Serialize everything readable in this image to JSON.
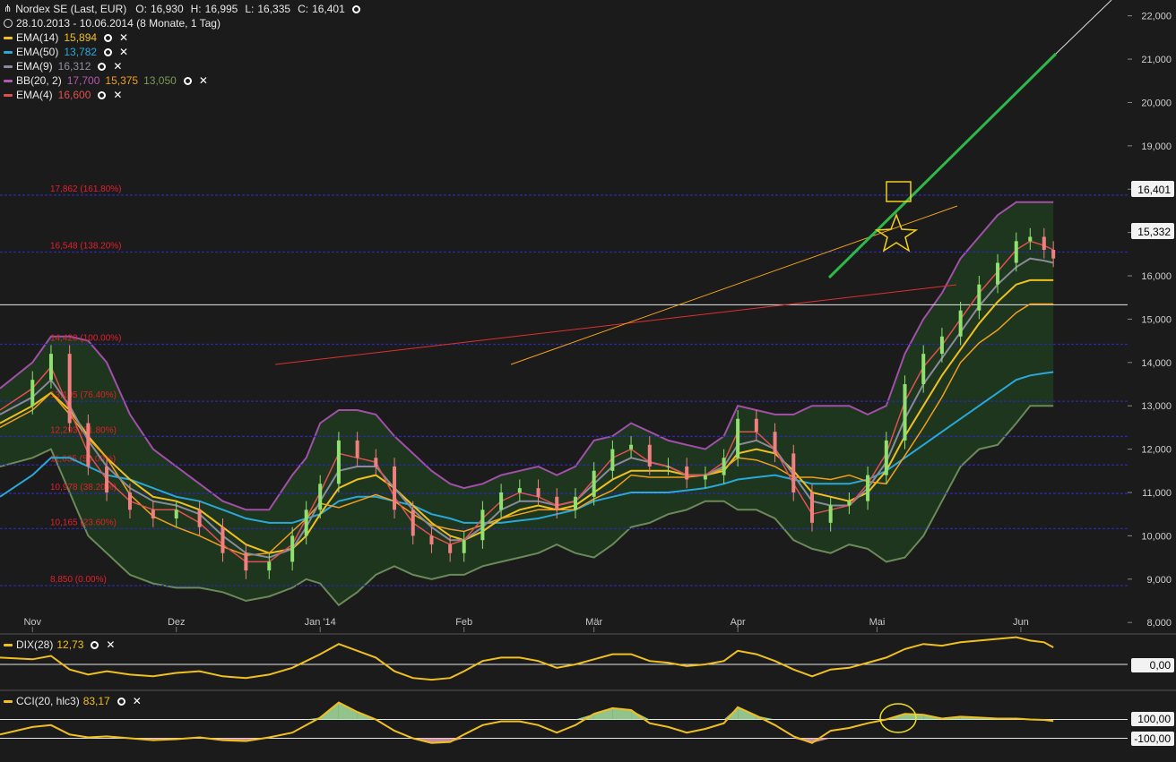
{
  "header": {
    "title": "Nordex SE (Last, EUR)",
    "ohlc": {
      "o_label": "O:",
      "o": "16,930",
      "h_label": "H:",
      "h": "16,995",
      "l_label": "L:",
      "l": "16,335",
      "c_label": "C:",
      "c": "16,401"
    },
    "period": "28.10.2013 - 10.06.2014 (8 Monate, 1 Tag)"
  },
  "indicators": [
    {
      "label": "EMA(14)",
      "values": [
        "15,894"
      ],
      "colors": [
        "#f0c020"
      ],
      "swatch": "#f0c020"
    },
    {
      "label": "EMA(50)",
      "values": [
        "13,782"
      ],
      "colors": [
        "#2aa8d8"
      ],
      "swatch": "#2aa8d8"
    },
    {
      "label": "EMA(9)",
      "values": [
        "16,312"
      ],
      "colors": [
        "#9090a0"
      ],
      "swatch": "#8a8a9a"
    },
    {
      "label": "BB(20, 2)",
      "values": [
        "17,700",
        "15,375",
        "13,050"
      ],
      "colors": [
        "#b05ab0",
        "#f0a020",
        "#7a9a5a"
      ],
      "swatch": "#b05ab0"
    },
    {
      "label": "EMA(4)",
      "values": [
        "16,600"
      ],
      "colors": [
        "#e05050"
      ],
      "swatch": "#e05050"
    }
  ],
  "price_tags": {
    "last": "16,401",
    "line": "15,332"
  },
  "fib_levels": [
    {
      "label": "17,862 (161.80%)",
      "value": 17.862
    },
    {
      "label": "16,548 (138.20%)",
      "value": 16.548
    },
    {
      "label": "14,420 (100.00%)",
      "value": 14.42
    },
    {
      "label": "13,105 (76.40%)",
      "value": 13.105
    },
    {
      "label": "12,293 (61.80%)",
      "value": 12.293
    },
    {
      "label": "11,635 (50.00%)",
      "value": 11.635
    },
    {
      "label": "10,978 (38.20%)",
      "value": 10.978
    },
    {
      "label": "10,165 (23.60%)",
      "value": 10.165
    },
    {
      "label": "8,850 (0.00%)",
      "value": 8.85
    }
  ],
  "dix": {
    "label": "DIX(28)",
    "value": "12,73",
    "zero_tag": "0,00",
    "color": "#f0c020"
  },
  "cci": {
    "label": "CCI(20, hlc3)",
    "value": "83,17",
    "tags": [
      "100,00",
      "-100,00"
    ],
    "color": "#f0c020"
  },
  "colors": {
    "background": "#1b1b1b",
    "band_fill": "#1e3a1e",
    "fib_line": "#2a2aa8",
    "fib_text": "#e02030",
    "up": "#90e070",
    "down": "#f08080"
  },
  "chart_data": {
    "type": "candlestick",
    "title": "Nordex SE (Last, EUR)",
    "ylim": [
      7.9,
      22.2
    ],
    "yticks": [
      "22,000",
      "21,000",
      "20,000",
      "19,000",
      "18,000",
      "17,000",
      "16,000",
      "15,000",
      "14,000",
      "13,000",
      "12,000",
      "11,000",
      "10,000",
      "9,000",
      "8,000"
    ],
    "ytick_values": [
      22,
      21,
      20,
      19,
      18,
      17,
      16,
      15,
      14,
      13,
      12,
      11,
      10,
      9,
      8
    ],
    "x_labels": [
      "Nov",
      "Dez",
      "Jan '14",
      "Feb",
      "Mär",
      "Apr",
      "Mai",
      "Jun"
    ],
    "x_label_days": [
      4,
      35,
      66,
      97,
      125,
      156,
      186,
      217
    ],
    "x_range_days": [
      -3,
      240
    ],
    "close_series_days": [
      -3,
      4,
      8,
      12,
      16,
      20,
      25,
      30,
      35,
      40,
      45,
      50,
      55,
      60,
      63,
      66,
      70,
      74,
      78,
      82,
      86,
      90,
      94,
      97,
      101,
      105,
      109,
      113,
      117,
      121,
      125,
      129,
      133,
      137,
      141,
      145,
      149,
      153,
      156,
      160,
      164,
      168,
      172,
      176,
      180,
      184,
      188,
      192,
      196,
      200,
      204,
      208,
      212,
      216,
      219,
      222,
      224
    ],
    "close_series": [
      13.0,
      13.6,
      14.2,
      12.6,
      11.6,
      11.0,
      10.6,
      10.4,
      10.6,
      10.2,
      9.6,
      9.2,
      9.4,
      10.0,
      10.6,
      11.2,
      12.2,
      11.8,
      11.6,
      10.6,
      10.0,
      9.8,
      9.6,
      9.9,
      10.6,
      11.0,
      11.1,
      10.9,
      10.6,
      10.9,
      11.5,
      12.0,
      12.1,
      11.6,
      11.6,
      11.3,
      11.4,
      11.8,
      12.7,
      12.4,
      11.9,
      11.0,
      10.3,
      10.7,
      10.8,
      11.4,
      12.2,
      13.5,
      14.2,
      14.6,
      15.2,
      15.8,
      16.3,
      16.8,
      16.9,
      16.6,
      16.4
    ],
    "band_upper": [
      13.4,
      14.0,
      14.6,
      14.6,
      14.5,
      14.0,
      12.8,
      12.0,
      11.6,
      11.2,
      10.8,
      10.6,
      10.6,
      11.4,
      11.8,
      12.6,
      12.9,
      12.9,
      12.8,
      12.3,
      11.9,
      11.5,
      11.2,
      11.1,
      11.2,
      11.4,
      11.5,
      11.6,
      11.4,
      11.6,
      12.2,
      12.3,
      12.6,
      12.4,
      12.2,
      12.1,
      12.0,
      12.3,
      13.0,
      12.9,
      12.8,
      12.8,
      13.0,
      13.0,
      13.0,
      12.8,
      13.0,
      14.2,
      15.0,
      15.6,
      16.4,
      16.9,
      17.4,
      17.7,
      17.7,
      17.7,
      17.7
    ],
    "band_lower": [
      11.6,
      11.8,
      12.0,
      11.0,
      10.0,
      9.6,
      9.1,
      8.9,
      8.8,
      8.8,
      8.7,
      8.5,
      8.6,
      8.8,
      9.0,
      8.9,
      8.4,
      8.7,
      9.1,
      9.3,
      9.1,
      9.0,
      9.1,
      9.1,
      9.3,
      9.4,
      9.5,
      9.6,
      9.8,
      9.6,
      9.5,
      9.8,
      10.2,
      10.3,
      10.5,
      10.6,
      10.8,
      10.8,
      10.6,
      10.6,
      10.4,
      9.9,
      9.7,
      9.6,
      9.8,
      9.7,
      9.4,
      9.5,
      10.0,
      10.8,
      11.6,
      12.0,
      12.1,
      12.6,
      13.0,
      13.0,
      13.0
    ],
    "ema50": [
      10.9,
      11.4,
      11.8,
      11.8,
      11.6,
      11.4,
      11.3,
      11.1,
      10.9,
      10.8,
      10.6,
      10.4,
      10.3,
      10.3,
      10.4,
      10.5,
      10.8,
      10.9,
      10.9,
      10.8,
      10.7,
      10.5,
      10.4,
      10.3,
      10.3,
      10.3,
      10.35,
      10.4,
      10.5,
      10.6,
      10.8,
      10.9,
      11.0,
      11.0,
      11.0,
      11.05,
      11.1,
      11.2,
      11.3,
      11.35,
      11.4,
      11.3,
      11.2,
      11.2,
      11.2,
      11.3,
      11.5,
      11.8,
      12.1,
      12.4,
      12.7,
      13.0,
      13.3,
      13.6,
      13.7,
      13.75,
      13.78
    ],
    "ema14": [
      12.6,
      13.0,
      13.3,
      12.9,
      12.3,
      11.8,
      11.3,
      10.9,
      10.8,
      10.6,
      10.2,
      9.8,
      9.6,
      9.7,
      10.0,
      10.5,
      11.1,
      11.3,
      11.4,
      11.1,
      10.7,
      10.3,
      10.0,
      9.9,
      10.1,
      10.4,
      10.6,
      10.7,
      10.6,
      10.7,
      11.0,
      11.3,
      11.5,
      11.5,
      11.5,
      11.4,
      11.4,
      11.5,
      11.9,
      12.0,
      11.9,
      11.5,
      11.0,
      10.9,
      10.8,
      11.0,
      11.5,
      12.3,
      13.0,
      13.7,
      14.3,
      14.9,
      15.4,
      15.8,
      15.9,
      15.9,
      15.9
    ],
    "ema9": [
      12.8,
      13.2,
      13.6,
      13.0,
      12.2,
      11.6,
      11.1,
      10.8,
      10.7,
      10.5,
      10.0,
      9.6,
      9.5,
      9.7,
      10.2,
      10.8,
      11.5,
      11.6,
      11.6,
      11.1,
      10.6,
      10.2,
      9.9,
      9.9,
      10.2,
      10.6,
      10.8,
      10.8,
      10.7,
      10.8,
      11.2,
      11.6,
      11.8,
      11.7,
      11.6,
      11.4,
      11.4,
      11.6,
      12.1,
      12.2,
      12.0,
      11.4,
      10.8,
      10.7,
      10.7,
      11.1,
      11.7,
      12.7,
      13.5,
      14.1,
      14.7,
      15.3,
      15.8,
      16.2,
      16.4,
      16.35,
      16.3
    ],
    "ema4": [
      12.9,
      13.4,
      13.9,
      12.9,
      11.9,
      11.3,
      10.8,
      10.6,
      10.6,
      10.3,
      9.8,
      9.4,
      9.4,
      9.8,
      10.4,
      11.0,
      11.9,
      11.8,
      11.7,
      10.9,
      10.3,
      10.0,
      9.8,
      9.9,
      10.4,
      10.8,
      11.0,
      10.9,
      10.7,
      10.8,
      11.3,
      11.8,
      12.0,
      11.7,
      11.6,
      11.4,
      11.4,
      11.7,
      12.4,
      12.4,
      12.0,
      11.2,
      10.5,
      10.6,
      10.7,
      11.2,
      11.9,
      13.1,
      13.9,
      14.4,
      15.0,
      15.6,
      16.1,
      16.6,
      16.8,
      16.7,
      16.6
    ],
    "dix_series": [
      4,
      3,
      5,
      -3,
      -6,
      -4,
      -6,
      -7,
      -5,
      -4,
      -7,
      -8,
      -6,
      -2,
      2,
      6,
      12,
      8,
      4,
      -4,
      -8,
      -9,
      -8,
      -4,
      2,
      4,
      4,
      2,
      -2,
      0,
      3,
      6,
      6,
      2,
      1,
      -1,
      0,
      2,
      8,
      6,
      2,
      -3,
      -7,
      -3,
      -2,
      1,
      4,
      9,
      12,
      11,
      13,
      14,
      15,
      16,
      14,
      13,
      10
    ],
    "cci_series": [
      -60,
      20,
      40,
      -60,
      -90,
      -80,
      -100,
      -120,
      -110,
      -90,
      -120,
      -130,
      -90,
      -40,
      40,
      120,
      280,
      180,
      100,
      -20,
      -100,
      -150,
      -140,
      -60,
      40,
      80,
      80,
      40,
      -40,
      40,
      160,
      220,
      200,
      60,
      20,
      -40,
      0,
      60,
      230,
      140,
      40,
      -80,
      -150,
      -20,
      10,
      60,
      100,
      160,
      150,
      110,
      130,
      120,
      110,
      110,
      100,
      95,
      83
    ]
  }
}
